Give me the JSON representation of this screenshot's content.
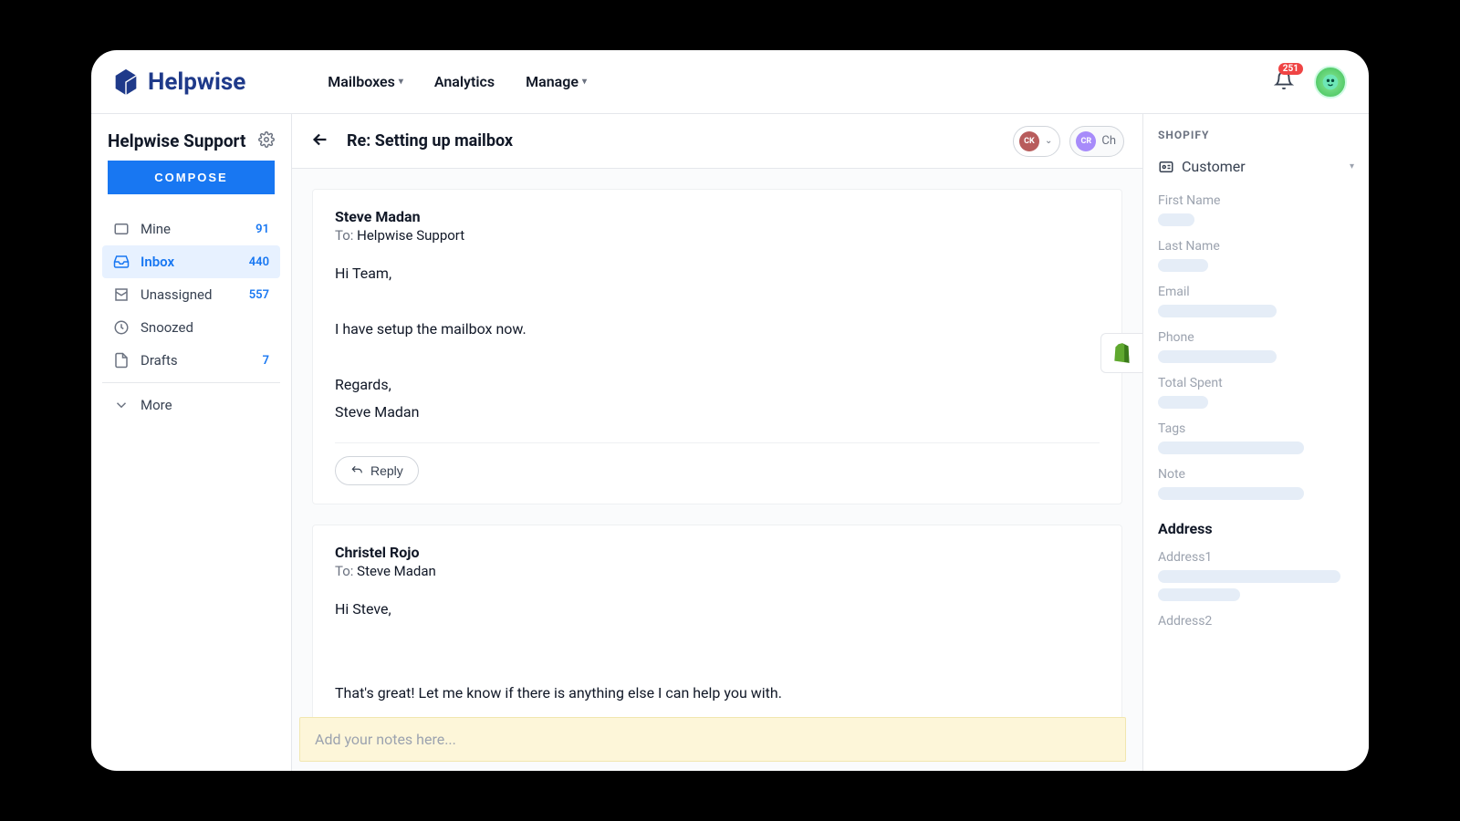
{
  "brand": {
    "name": "Helpwise"
  },
  "topnav": {
    "mailboxes": "Mailboxes",
    "analytics": "Analytics",
    "manage": "Manage",
    "notification_count": "251"
  },
  "sidebar": {
    "title": "Helpwise Support",
    "compose_label": "Compose",
    "items": [
      {
        "label": "Mine",
        "count": "91"
      },
      {
        "label": "Inbox",
        "count": "440"
      },
      {
        "label": "Unassigned",
        "count": "557"
      },
      {
        "label": "Snoozed",
        "count": ""
      },
      {
        "label": "Drafts",
        "count": "7"
      },
      {
        "label": "More",
        "count": ""
      }
    ]
  },
  "thread": {
    "subject": "Re: Setting up mailbox",
    "assignees": [
      {
        "initials": "CK",
        "name": ""
      },
      {
        "initials": "CR",
        "name": "Ch"
      }
    ],
    "messages": [
      {
        "from": "Steve Madan",
        "to_label": "To:",
        "to": "Helpwise Support",
        "body": "Hi Team,\n\nI have setup the mailbox now.\n\nRegards,\nSteve Madan",
        "reply_label": "Reply"
      },
      {
        "from": "Christel Rojo",
        "to_label": "To:",
        "to": "Steve Madan",
        "body": "Hi Steve,\n\n\nThat's great! Let me know if there is anything else I can help you with."
      }
    ],
    "notes_placeholder": "Add your notes here..."
  },
  "shopify": {
    "title": "SHOPIFY",
    "section": "Customer",
    "fields": {
      "first_name": "First Name",
      "last_name": "Last Name",
      "email": "Email",
      "phone": "Phone",
      "total_spent": "Total Spent",
      "tags": "Tags",
      "note": "Note"
    },
    "address_heading": "Address",
    "address1": "Address1",
    "address2": "Address2"
  }
}
